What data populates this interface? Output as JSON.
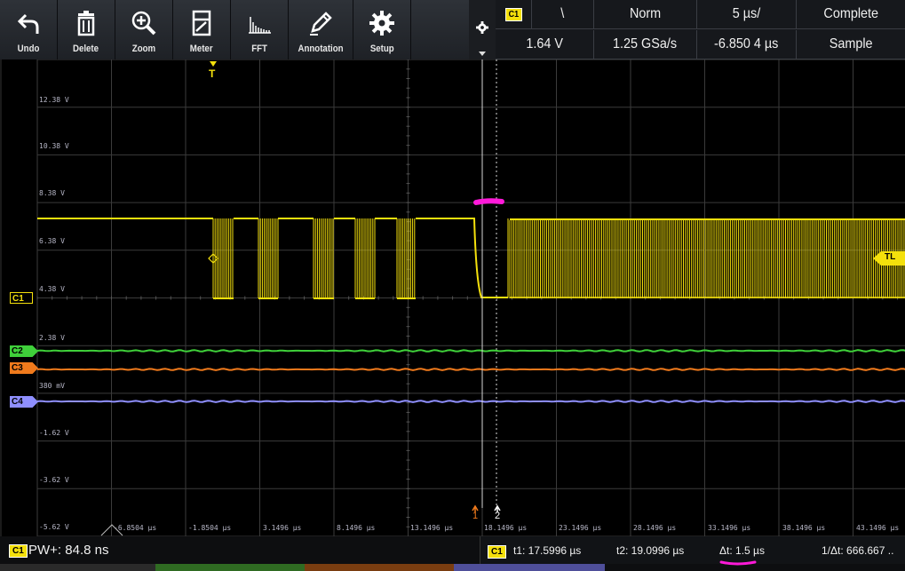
{
  "toolbar": {
    "undo": "Undo",
    "delete": "Delete",
    "zoom": "Zoom",
    "meter": "Meter",
    "fft": "FFT",
    "annotation": "Annotation",
    "setup": "Setup"
  },
  "status": {
    "channel": "C1",
    "edge_symbol": "\\",
    "trigger_mode": "Norm",
    "timebase": "5 µs/",
    "acq_state": "Complete",
    "trigger_level": "1.64 V",
    "sample_rate": "1.25 GSa/s",
    "delay": "-6.850 4 µs",
    "acq_mode": "Sample"
  },
  "grid": {
    "trigger_marker": "T",
    "trigger_level_tag": "TL",
    "cursor1": "1",
    "cursor2": "2",
    "volt_labels": [
      "12.38 V",
      "10.38 V",
      "8.38 V",
      "6.38 V",
      "4.38 V",
      "2.38 V",
      "380 mV",
      "-1.62 V",
      "-3.62 V",
      "-5.62 V"
    ],
    "time_labels": [
      "-6.8504 µs",
      "-1.8504 µs",
      "3.1496 µs",
      "8.1496 µs",
      "13.1496 µs",
      "18.1496 µs",
      "23.1496 µs",
      "28.1496 µs",
      "33.1496 µs",
      "38.1496 µs",
      "43.1496 µs"
    ],
    "channels": [
      {
        "name": "C1",
        "color": "#f4e00c"
      },
      {
        "name": "C2",
        "color": "#3fd03a"
      },
      {
        "name": "C3",
        "color": "#f07a1c"
      },
      {
        "name": "C4",
        "color": "#8f8fff"
      }
    ]
  },
  "bottom": {
    "channel": "C1",
    "measurement": "PW+: 84.8 ns",
    "cursor_channel": "C1",
    "t1": "t1: 17.5996 µs",
    "t2": "t2: 19.0996 µs",
    "dt": "Δt: 1.5 µs",
    "inv_dt": "1/Δt: 666.667 .."
  }
}
